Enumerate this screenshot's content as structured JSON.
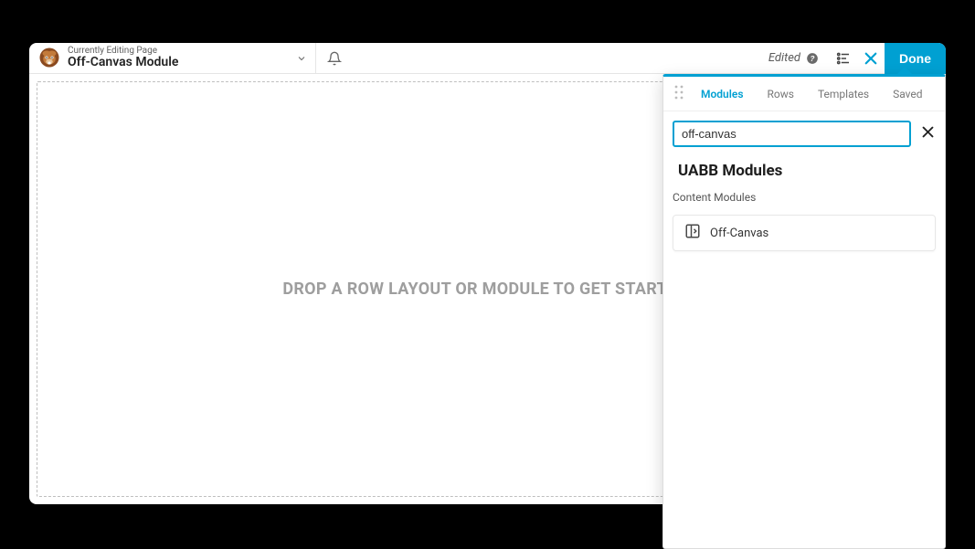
{
  "header": {
    "pre_title": "Currently Editing Page",
    "page_title": "Off-Canvas Module",
    "edited_label": "Edited",
    "done_label": "Done"
  },
  "canvas": {
    "drop_placeholder": "DROP A ROW LAYOUT OR MODULE TO GET STARTED!"
  },
  "panel": {
    "tabs": {
      "modules": "Modules",
      "rows": "Rows",
      "templates": "Templates",
      "saved": "Saved"
    },
    "search_value": "off-canvas",
    "section_title": "UABB Modules",
    "section_sub": "Content Modules",
    "results": {
      "off_canvas": "Off-Canvas"
    }
  }
}
